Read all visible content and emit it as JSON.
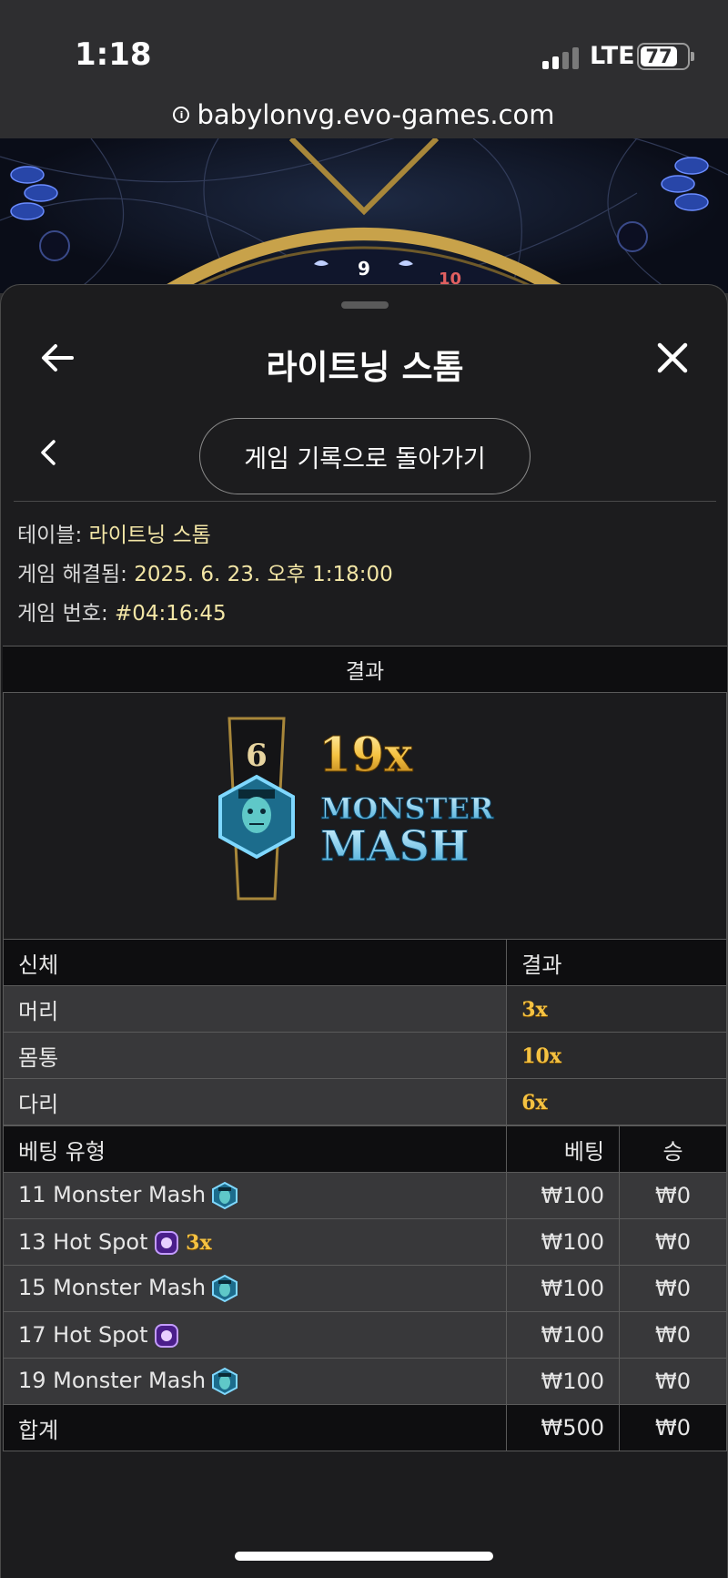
{
  "status_bar": {
    "time": "1:18",
    "network": "LTE",
    "battery": "77"
  },
  "browser": {
    "url": "babylonvg.evo-games.com"
  },
  "hero": {
    "wheel_numbers": [
      "9",
      "10"
    ]
  },
  "header": {
    "title": "라이트닝 스톰"
  },
  "nav": {
    "back_to_history": "게임 기록으로 돌아가기"
  },
  "info": {
    "table_label": "테이블:",
    "table_value": "라이트닝 스톰",
    "resolved_label": "게임 해결됨:",
    "resolved_value": "2025. 6. 23. 오후 1:18:00",
    "game_no_label": "게임 번호:",
    "game_no_value": "#04:16:45"
  },
  "result": {
    "header": "결과",
    "segment_number": "6",
    "multiplier": "19x",
    "name_line1": "MONSTER",
    "name_line2": "MASH"
  },
  "body_table": {
    "col_part": "신체",
    "col_result": "결과",
    "rows": [
      {
        "part": "머리",
        "value": "3x"
      },
      {
        "part": "몸통",
        "value": "10x"
      },
      {
        "part": "다리",
        "value": "6x"
      }
    ]
  },
  "bet_table": {
    "col_type": "베팅 유형",
    "col_bet": "베팅",
    "col_win": "승",
    "rows": [
      {
        "type": "11 Monster Mash",
        "icon": "monster-mash-icon",
        "extra": "",
        "bet": "₩100",
        "win": "₩0"
      },
      {
        "type": "13 Hot Spot",
        "icon": "hot-spot-icon",
        "extra": "3x",
        "bet": "₩100",
        "win": "₩0"
      },
      {
        "type": "15 Monster Mash",
        "icon": "monster-mash-icon",
        "extra": "",
        "bet": "₩100",
        "win": "₩0"
      },
      {
        "type": "17 Hot Spot",
        "icon": "hot-spot-icon",
        "extra": "",
        "bet": "₩100",
        "win": "₩0"
      },
      {
        "type": "19 Monster Mash",
        "icon": "monster-mash-icon",
        "extra": "",
        "bet": "₩100",
        "win": "₩0"
      }
    ],
    "total_label": "합계",
    "total_bet": "₩500",
    "total_win": "₩0"
  },
  "colors": {
    "accent_gold": "#f3e6a6",
    "multiplier_gold": "#f5c242",
    "sheet_bg": "#1c1c1e"
  }
}
